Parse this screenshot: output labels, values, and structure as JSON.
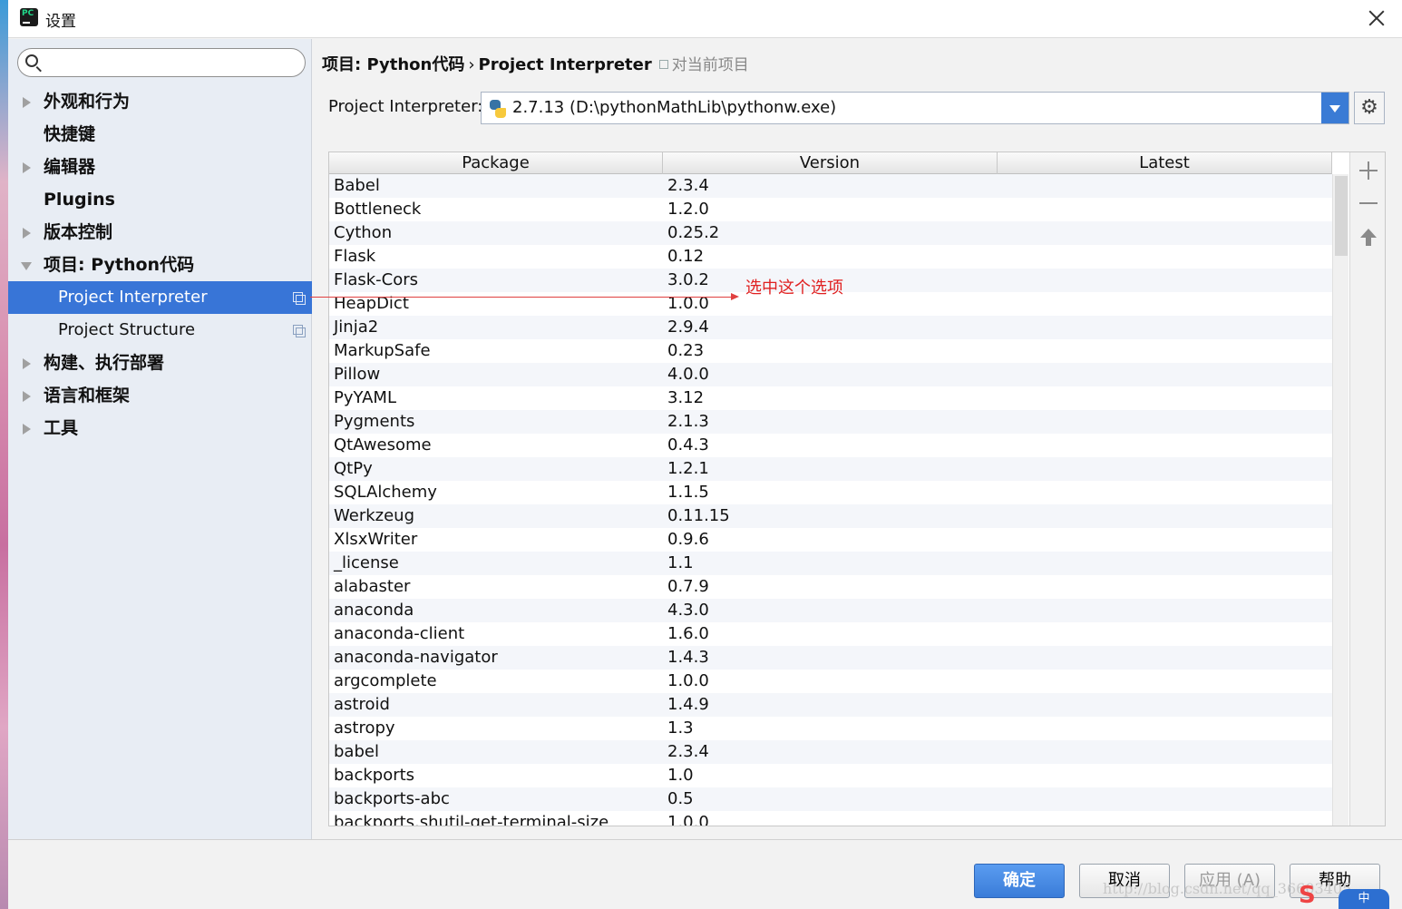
{
  "window": {
    "title": "设置"
  },
  "search": {
    "placeholder": "",
    "value": ""
  },
  "sidebar": {
    "items": [
      {
        "label": "外观和行为",
        "arrow": "right"
      },
      {
        "label": "快捷键"
      },
      {
        "label": "编辑器",
        "arrow": "right"
      },
      {
        "label": "Plugins"
      },
      {
        "label": "版本控制",
        "arrow": "right"
      },
      {
        "label": "项目: Python代码",
        "arrow": "down"
      },
      {
        "label": "Project Interpreter",
        "sub": true,
        "selected": true
      },
      {
        "label": "Project Structure",
        "sub": true
      },
      {
        "label": "构建、执行部署",
        "arrow": "right"
      },
      {
        "label": "语言和框架",
        "arrow": "right"
      },
      {
        "label": "工具",
        "arrow": "right"
      }
    ]
  },
  "breadcrumb": {
    "project": "项目: Python代码",
    "separator": "›",
    "page": "Project Interpreter",
    "scope": "对当前项目"
  },
  "interpreter": {
    "label": "Project Interpreter:",
    "value": "2.7.13 (D:\\pythonMathLib\\pythonw.exe)"
  },
  "table": {
    "headers": [
      "Package",
      "Version",
      "Latest"
    ],
    "rows": [
      [
        "Babel",
        "2.3.4",
        ""
      ],
      [
        "Bottleneck",
        "1.2.0",
        ""
      ],
      [
        "Cython",
        "0.25.2",
        ""
      ],
      [
        "Flask",
        "0.12",
        ""
      ],
      [
        "Flask-Cors",
        "3.0.2",
        ""
      ],
      [
        "HeapDict",
        "1.0.0",
        ""
      ],
      [
        "Jinja2",
        "2.9.4",
        ""
      ],
      [
        "MarkupSafe",
        "0.23",
        ""
      ],
      [
        "Pillow",
        "4.0.0",
        ""
      ],
      [
        "PyYAML",
        "3.12",
        ""
      ],
      [
        "Pygments",
        "2.1.3",
        ""
      ],
      [
        "QtAwesome",
        "0.4.3",
        ""
      ],
      [
        "QtPy",
        "1.2.1",
        ""
      ],
      [
        "SQLAlchemy",
        "1.1.5",
        ""
      ],
      [
        "Werkzeug",
        "0.11.15",
        ""
      ],
      [
        "XlsxWriter",
        "0.9.6",
        ""
      ],
      [
        "_license",
        "1.1",
        ""
      ],
      [
        "alabaster",
        "0.7.9",
        ""
      ],
      [
        "anaconda",
        "4.3.0",
        ""
      ],
      [
        "anaconda-client",
        "1.6.0",
        ""
      ],
      [
        "anaconda-navigator",
        "1.4.3",
        ""
      ],
      [
        "argcomplete",
        "1.0.0",
        ""
      ],
      [
        "astroid",
        "1.4.9",
        ""
      ],
      [
        "astropy",
        "1.3",
        ""
      ],
      [
        "babel",
        "2.3.4",
        ""
      ],
      [
        "backports",
        "1.0",
        ""
      ],
      [
        "backports-abc",
        "0.5",
        ""
      ],
      [
        "backports.shutil-get-terminal-size",
        "1.0.0",
        ""
      ]
    ]
  },
  "annotation": {
    "text": "选中这个选项",
    "color": "#e02020"
  },
  "footer": {
    "ok": "确定",
    "cancel": "取消",
    "apply": "应用 (A)",
    "help": "帮助",
    "watermark": "http://blog.csdn.net/qq_36603405"
  },
  "colors": {
    "accent": "#3875d7",
    "primary_button": "#3a7cd8"
  }
}
